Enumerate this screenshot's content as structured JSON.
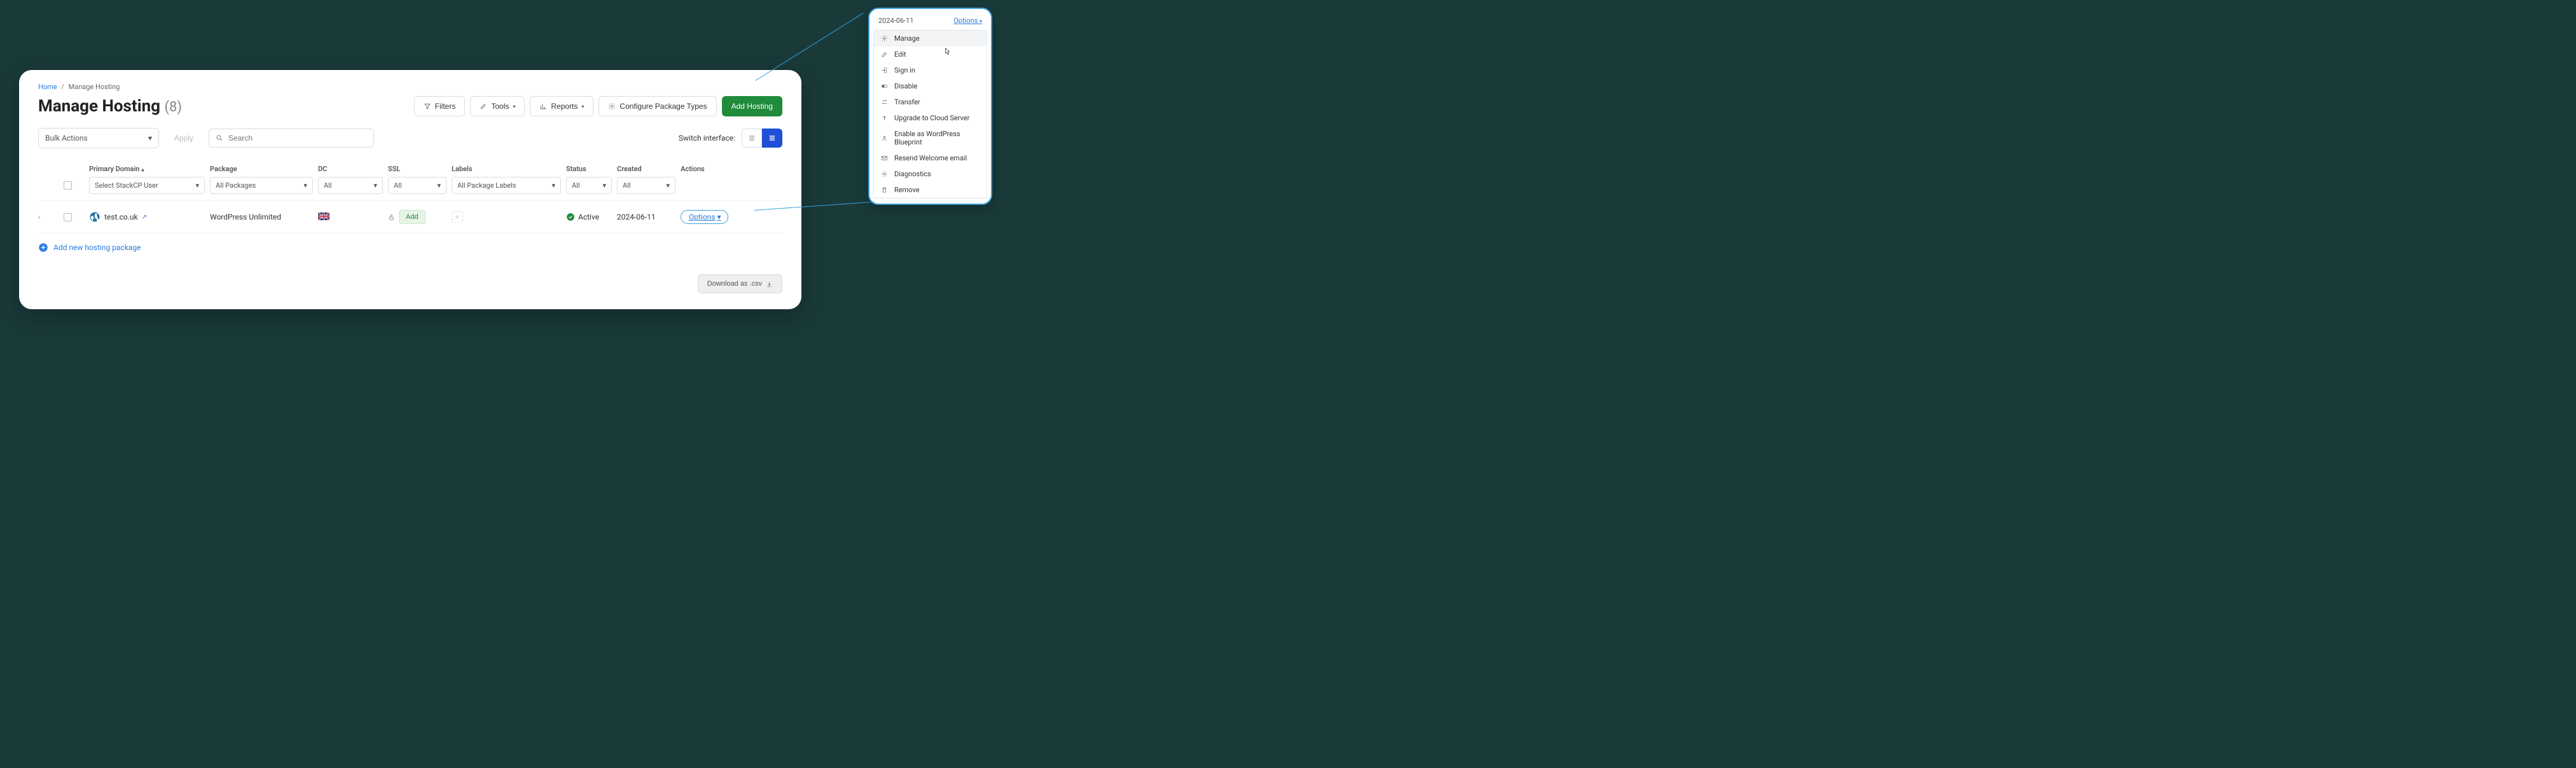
{
  "breadcrumb": {
    "home": "Home",
    "current": "Manage Hosting"
  },
  "page": {
    "title": "Manage Hosting",
    "count": "(8)"
  },
  "header_buttons": {
    "filters": "Filters",
    "tools": "Tools",
    "reports": "Reports",
    "configure": "Configure Package Types",
    "add": "Add Hosting"
  },
  "toolbar": {
    "bulk": "Bulk Actions",
    "apply": "Apply",
    "search_placeholder": "Search",
    "switch_label": "Switch interface:"
  },
  "columns": {
    "primary_domain": "Primary Domain",
    "package": "Package",
    "dc": "DC",
    "ssl": "SSL",
    "labels": "Labels",
    "status": "Status",
    "created": "Created",
    "actions": "Actions"
  },
  "filters": {
    "user": "Select StackCP User",
    "packages": "All Packages",
    "dc": "All",
    "ssl": "All",
    "labels": "All Package Labels",
    "status": "All",
    "created": "All"
  },
  "row": {
    "domain": "test.co.uk",
    "package": "WordPress Unlimited",
    "ssl_add": "Add",
    "status": "Active",
    "created": "2024-06-11",
    "options": "Options"
  },
  "add_row": "Add new hosting package",
  "download": "Download as .csv",
  "popout": {
    "date": "2024-06-11",
    "options": "Options",
    "items": {
      "manage": "Manage",
      "edit": "Edit",
      "signin": "Sign in",
      "disable": "Disable",
      "transfer": "Transfer",
      "upgrade": "Upgrade to Cloud Server",
      "blueprint": "Enable as WordPress Blueprint",
      "resend": "Resend Welcome email",
      "diagnostics": "Diagnostics",
      "remove": "Remove"
    }
  }
}
